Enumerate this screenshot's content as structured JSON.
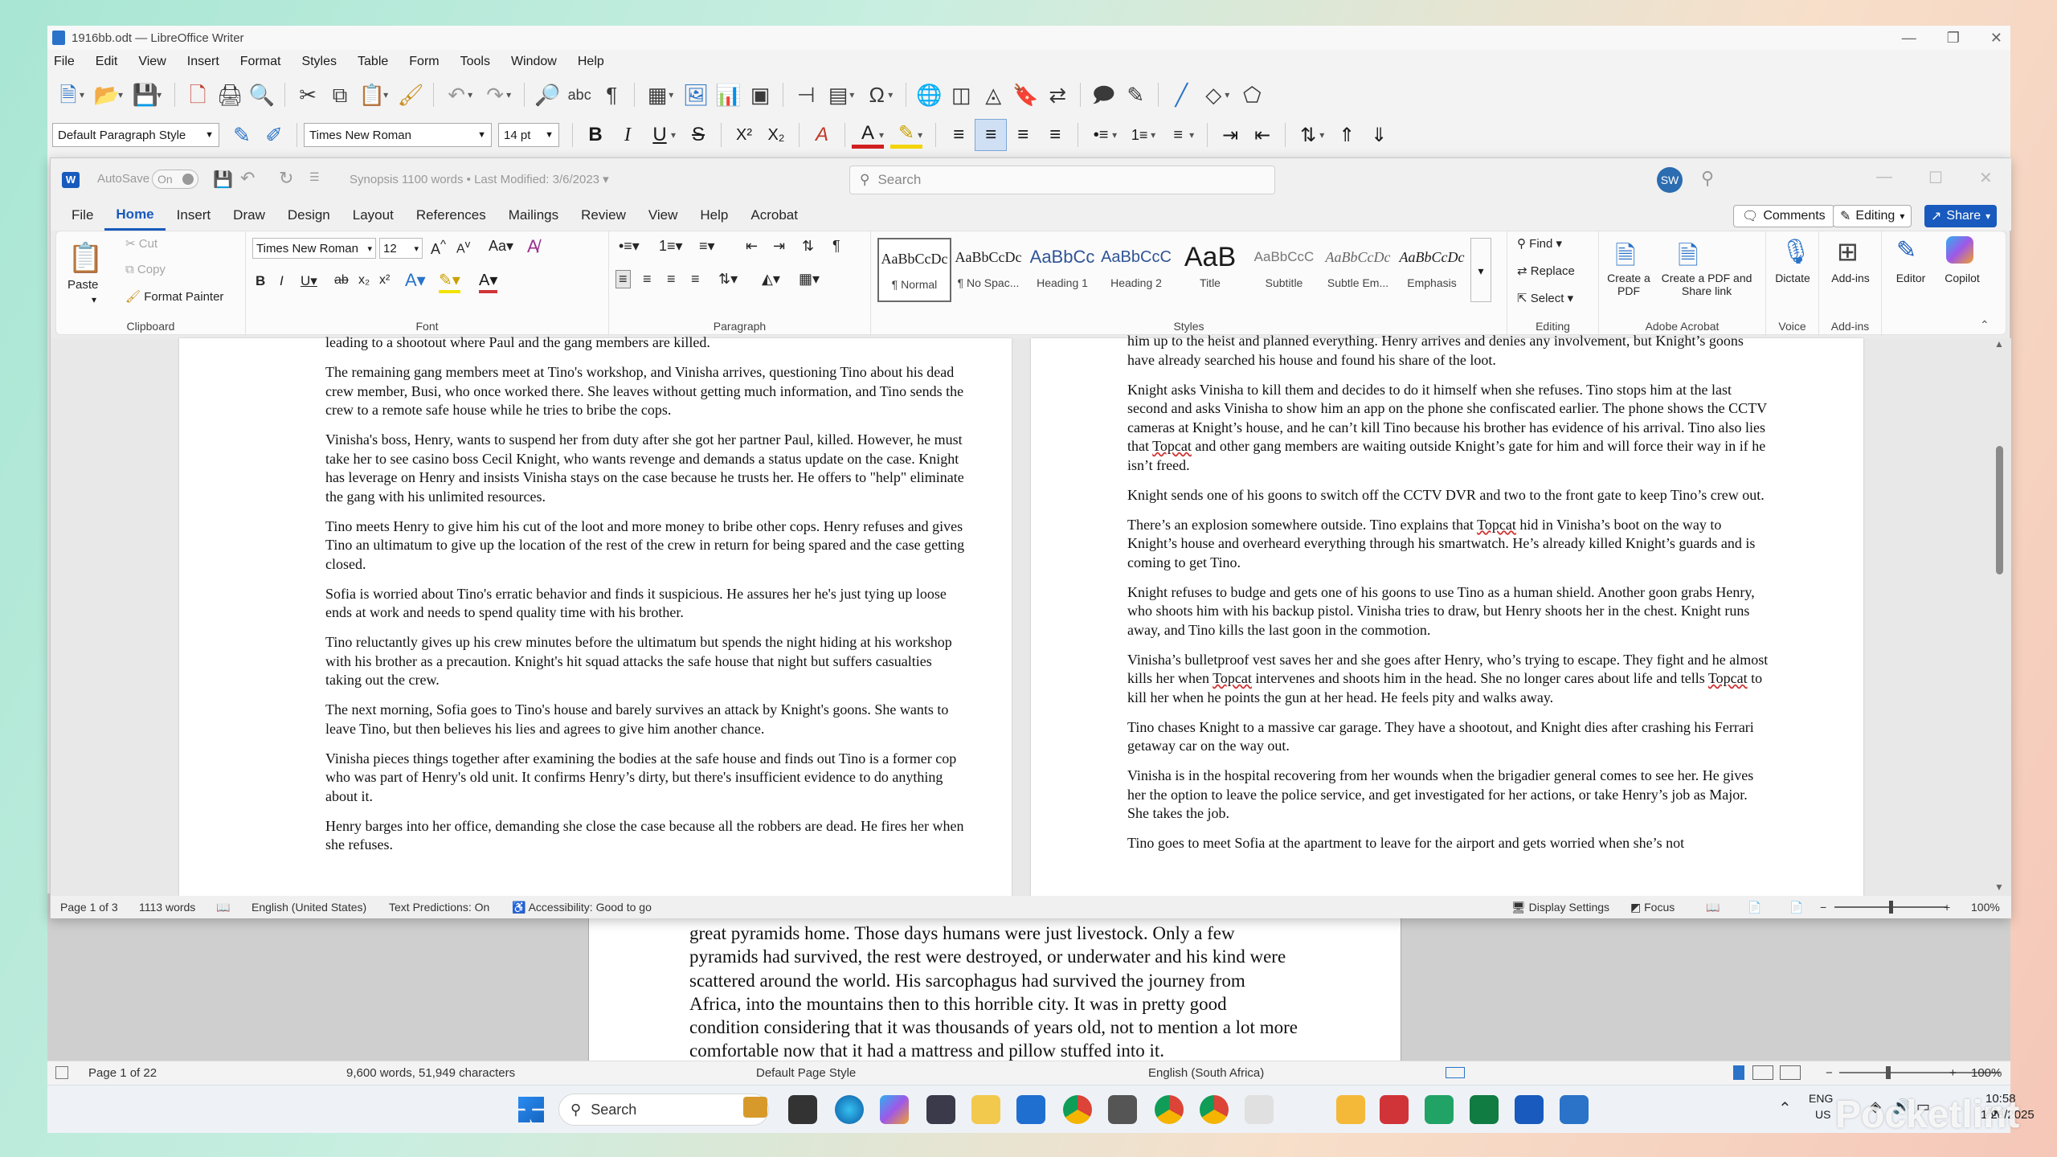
{
  "lo": {
    "title": "1916bb.odt — LibreOffice Writer",
    "menu": [
      "File",
      "Edit",
      "View",
      "Insert",
      "Format",
      "Styles",
      "Table",
      "Form",
      "Tools",
      "Window",
      "Help"
    ],
    "para_style": "Default Paragraph Style",
    "font_name": "Times New Roman",
    "font_size": "14 pt",
    "paragraph": "great pyramids home. Those days humans were just livestock. Only a few pyramids had survived, the rest were destroyed, or underwater and his kind were scattered around the world. His sarcophagus had survived the journey from Africa, into the mountains then to this horrible city. It was in pretty good condition considering that it was thousands of years old, not to mention a lot more comfortable now that it had a mattress and pillow stuffed into it.",
    "status": {
      "page": "Page 1 of 22",
      "words": "9,600 words, 51,949 characters",
      "page_style": "Default Page Style",
      "language": "English (South Africa)",
      "zoom": "100%"
    }
  },
  "word": {
    "autosave_label": "AutoSave",
    "autosave_state": "On",
    "doc_title": "Synopsis 1100 words",
    "modified": "Last Modified: 3/6/2023",
    "search_placeholder": "Search",
    "avatar": "SW",
    "tabs": [
      "File",
      "Home",
      "Insert",
      "Draw",
      "Design",
      "Layout",
      "References",
      "Mailings",
      "Review",
      "View",
      "Help",
      "Acrobat"
    ],
    "comments": "Comments",
    "editing": "Editing",
    "share": "Share",
    "clipboard": {
      "paste": "Paste",
      "cut": "Cut",
      "copy": "Copy",
      "painter": "Format Painter",
      "label": "Clipboard"
    },
    "font": {
      "name": "Times New Roman",
      "size": "12",
      "label": "Font"
    },
    "paragraph_label": "Paragraph",
    "styles_label": "Styles",
    "styles": [
      {
        "preview": "AaBbCcDc",
        "name": "¶ Normal"
      },
      {
        "preview": "AaBbCcDc",
        "name": "¶ No Spac..."
      },
      {
        "preview": "AaBbCc",
        "name": "Heading 1"
      },
      {
        "preview": "AaBbCcC",
        "name": "Heading 2"
      },
      {
        "preview": "AaB",
        "name": "Title"
      },
      {
        "preview": "AaBbCcC",
        "name": "Subtitle"
      },
      {
        "preview": "AaBbCcDc",
        "name": "Subtle Em..."
      },
      {
        "preview": "AaBbCcDc",
        "name": "Emphasis"
      }
    ],
    "editing_grp": {
      "find": "Find",
      "replace": "Replace",
      "select": "Select",
      "label": "Editing"
    },
    "acrobat": {
      "create_pdf": "Create a PDF",
      "create_share": "Create a PDF and Share link",
      "label": "Adobe Acrobat"
    },
    "voice": {
      "dictate": "Dictate",
      "label": "Voice"
    },
    "addins": {
      "addins": "Add-ins",
      "label": "Add-ins"
    },
    "editor": "Editor",
    "copilot": "Copilot",
    "left_paras": [
      "leading to a shootout where Paul and the gang members are killed.",
      "The remaining gang members meet at Tino's workshop, and Vinisha arrives, questioning Tino about his dead crew member, Busi, who once worked there. She leaves without getting much information, and Tino sends the crew to a remote safe house while he tries to bribe the cops.",
      "Vinisha's boss, Henry, wants to suspend her from duty after she got her partner Paul, killed. However, he must take her to see casino boss Cecil Knight, who wants revenge and demands a status update on the case. Knight has leverage on Henry and insists Vinisha stays on the case because he trusts her. He offers to \"help\" eliminate the gang with his unlimited resources.",
      "Tino meets Henry to give him his cut of the loot and more money to bribe other cops. Henry refuses and gives Tino an ultimatum to give up the location of the rest of the crew in return for being spared and the case getting closed.",
      "Sofia is worried about Tino's erratic behavior and finds it suspicious. He assures her he's just tying up loose ends at work and needs to spend quality time with his brother.",
      "Tino reluctantly gives up his crew minutes before the ultimatum but spends the night hiding at his workshop with his brother as a precaution. Knight's hit squad attacks the safe house that night but suffers casualties taking out the crew.",
      "The next morning, Sofia goes to Tino's house and barely survives an attack by Knight's goons. She wants to leave Tino, but then believes his lies and agrees to give him another chance.",
      "Vinisha pieces things together after examining the bodies at the safe house and finds out Tino is a former cop who was part of Henry's old unit. It confirms Henry’s dirty, but there's insufficient evidence to do anything about it.",
      "Henry barges into her office, demanding she close the case because all the robbers are dead. He fires her when she refuses."
    ],
    "right_paras": [
      "him up to the heist and planned everything. Henry arrives and denies any involvement, but Knight’s goons have already searched his house and found his share of the loot.",
      "Knight asks Vinisha to kill them and decides to do it himself when she refuses. Tino stops him at the last second and asks Vinisha to show him an app on the phone she confiscated earlier. The phone shows the CCTV cameras at Knight’s house, and he can’t kill Tino because his brother has evidence of his arrival. Tino also lies that Topcat and other gang members are waiting outside Knight’s gate for him and will force their way in if he isn’t freed.",
      "Knight sends one of his goons to switch off the CCTV DVR and two to the front gate to keep Tino’s crew out.",
      "There’s an explosion somewhere outside. Tino explains that Topcat hid in Vinisha’s boot on the way to Knight’s house and overheard everything through his smartwatch. He’s already killed Knight’s guards and is coming to get Tino.",
      "Knight refuses to budge and gets one of his goons to use Tino as a human shield. Another goon grabs Henry, who shoots him with his backup pistol. Vinisha tries to draw, but Henry shoots her in the chest. Knight runs away, and Tino kills the last goon in the commotion.",
      "Vinisha’s bulletproof vest saves her and she goes after Henry, who’s trying to escape. They fight and he almost kills her when Topcat intervenes and shoots him in the head. She no longer cares about life and tells Topcat to kill her when he points the gun at her head. He feels pity and walks away.",
      "Tino chases Knight to a massive car garage. They have a shootout, and Knight dies after crashing his Ferrari getaway car on the way out.",
      "Vinisha is in the hospital recovering from her wounds when the brigadier general comes to see her. He gives her the option to leave the police service, and get investigated for her actions, or take Henry’s job as Major. She takes the job.",
      "Tino goes to meet Sofia at the apartment to leave for the airport and gets worried when she’s not"
    ],
    "status": {
      "page": "Page 1 of 3",
      "words": "1113 words",
      "language": "English (United States)",
      "predictions": "Text Predictions: On",
      "accessibility": "Accessibility: Good to go",
      "display": "Display Settings",
      "focus": "Focus",
      "zoom": "100%"
    }
  },
  "taskbar": {
    "search": "Search",
    "lang1": "ENG",
    "lang2": "US",
    "time": "10:58 AM",
    "date": "1/23/2025"
  },
  "watermark": "Pocketlint",
  "colors": {
    "word_blue": "#185abd",
    "lo_blue": "#1a73e8",
    "accent_red": "#d13438"
  }
}
